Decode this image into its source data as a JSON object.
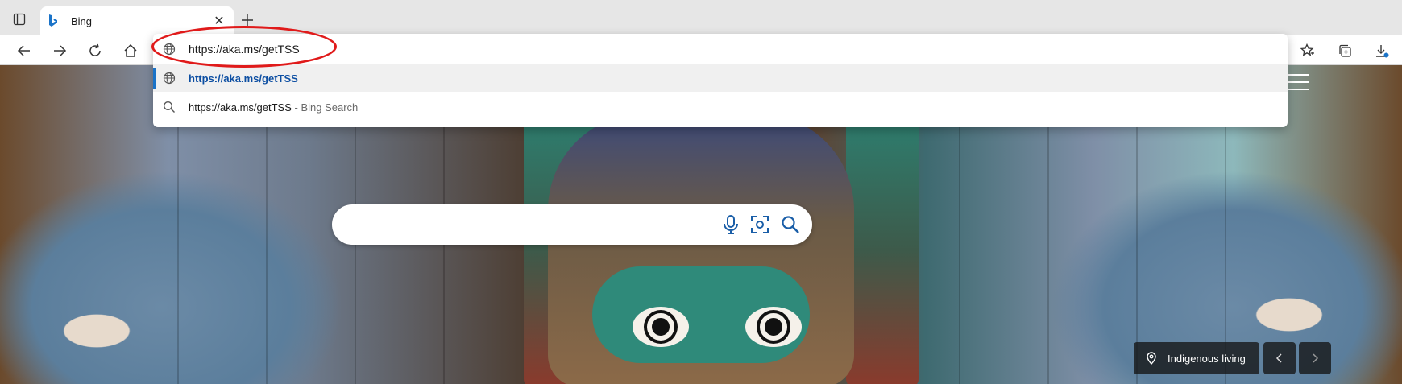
{
  "browser": {
    "tab": {
      "title": "Bing"
    },
    "address_bar": {
      "value": "https://aka.ms/getTSS"
    },
    "suggestions": [
      {
        "text": "https://aka.ms/getTSS",
        "suffix": "",
        "icon": "globe-icon"
      },
      {
        "text": "https://aka.ms/getTSS",
        "suffix": " - Bing Search",
        "icon": "search-icon"
      }
    ]
  },
  "bing": {
    "search": {
      "value": ""
    },
    "image_location": {
      "label": "Indigenous living"
    }
  },
  "colors": {
    "annotation": "#e01a1a",
    "selected_suggestion_text": "#0c4ea2",
    "bing_accent": "#1a73c8"
  }
}
